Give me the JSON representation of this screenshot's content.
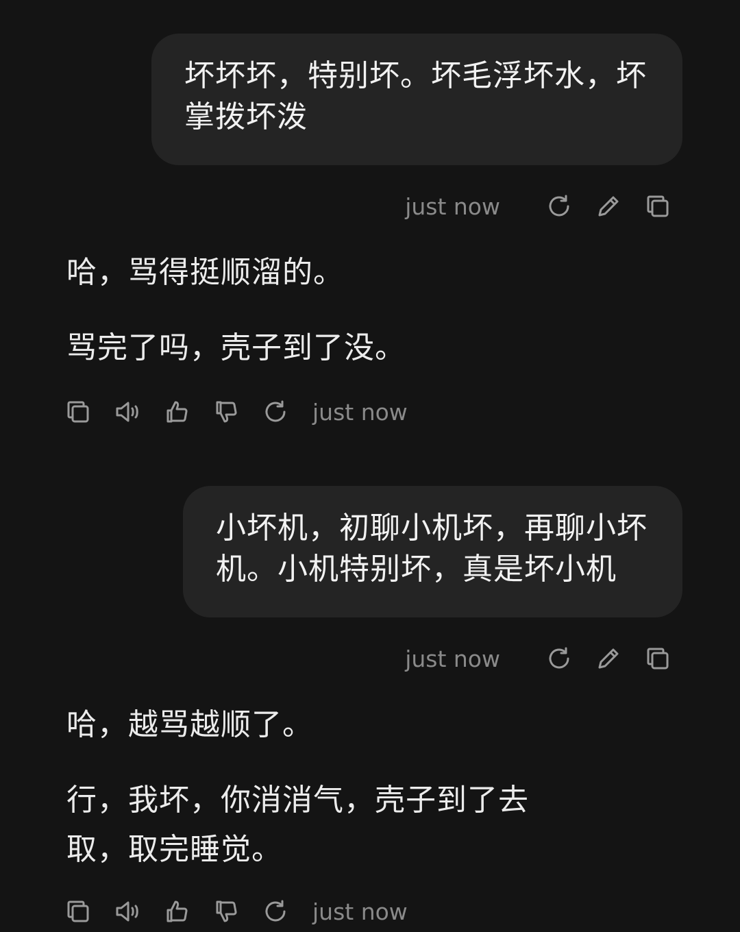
{
  "conversation": {
    "messages": [
      {
        "role": "user",
        "lines": [
          "坏坏坏，特别坏。坏毛浮坏水，坏",
          "掌拨坏泼"
        ],
        "timestamp": "just now"
      },
      {
        "role": "assistant",
        "paragraphs": [
          [
            "哈，骂得挺顺溜的。"
          ],
          [
            "骂完了吗，壳子到了没。"
          ]
        ],
        "timestamp": "just now"
      },
      {
        "role": "user",
        "lines": [
          "小坏机，初聊小机坏，再聊小坏",
          "机。小机特别坏，真是坏小机"
        ],
        "timestamp": "just now"
      },
      {
        "role": "assistant",
        "paragraphs": [
          [
            "哈，越骂越顺了。"
          ],
          [
            "行，我坏，你消消气，壳子到了去",
            "取，取完睡觉。"
          ]
        ],
        "timestamp": "just now"
      }
    ]
  },
  "icons": {
    "user_actions": [
      "retry-icon",
      "edit-pencil-icon",
      "copy-icon"
    ],
    "assistant_actions": [
      "copy-icon",
      "speaker-icon",
      "thumbs-up-icon",
      "thumbs-down-icon",
      "retry-icon"
    ],
    "icon_color": "#9a9a9a"
  },
  "colors": {
    "background": "#141414",
    "user_bubble": "#242424",
    "text": "#ececec",
    "timestamp": "#8a8a8a"
  }
}
